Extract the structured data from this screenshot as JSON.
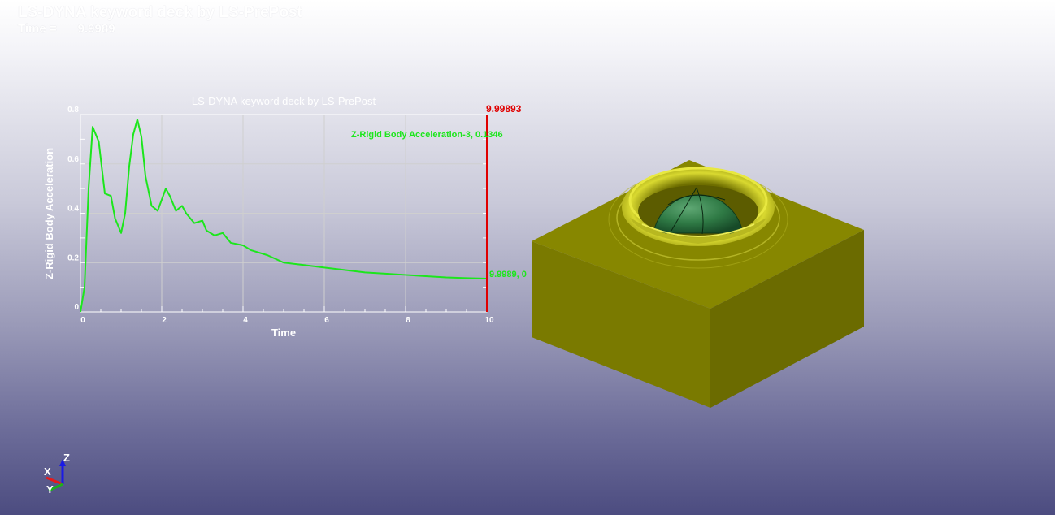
{
  "header": {
    "title": "LS-DYNA keyword deck by LS-PrePost",
    "time_label": "Time =",
    "time_value": "9.9989"
  },
  "chart_data": {
    "type": "line",
    "title": "LS-DYNA keyword deck by LS-PrePost",
    "xlabel": "Time",
    "ylabel": "Z-Rigid Body Acceleration",
    "xlim": [
      0,
      10
    ],
    "ylim": [
      0,
      0.8
    ],
    "x_ticks": [
      "0",
      "2",
      "4",
      "6",
      "8",
      "10"
    ],
    "y_ticks": [
      "0",
      "0.2",
      "0.4",
      "0.6",
      "0.8"
    ],
    "grid": true,
    "cursor_x": 10,
    "cursor_label": "9.99893",
    "series": [
      {
        "name": "Z-Rigid Body Acceleration-3, 0.1346",
        "color": "#1ce61c",
        "end_label": "9.9989, 0",
        "x": [
          0,
          0.1,
          0.2,
          0.3,
          0.45,
          0.6,
          0.75,
          0.85,
          1.0,
          1.1,
          1.2,
          1.3,
          1.4,
          1.5,
          1.6,
          1.75,
          1.9,
          2.1,
          2.2,
          2.35,
          2.5,
          2.6,
          2.8,
          3.0,
          3.1,
          3.3,
          3.5,
          3.7,
          4.0,
          4.2,
          4.6,
          5.0,
          5.5,
          6.0,
          6.5,
          7.0,
          7.5,
          8.0,
          8.5,
          9.0,
          9.5,
          10.0
        ],
        "y": [
          0,
          0.1,
          0.5,
          0.75,
          0.69,
          0.48,
          0.47,
          0.38,
          0.32,
          0.4,
          0.59,
          0.72,
          0.78,
          0.71,
          0.55,
          0.43,
          0.41,
          0.5,
          0.47,
          0.41,
          0.43,
          0.4,
          0.36,
          0.37,
          0.33,
          0.31,
          0.32,
          0.28,
          0.27,
          0.25,
          0.23,
          0.2,
          0.19,
          0.18,
          0.17,
          0.16,
          0.155,
          0.15,
          0.145,
          0.14,
          0.137,
          0.135
        ]
      }
    ]
  },
  "model": {
    "block_color": "#7a7a00",
    "sphere_color": "#2f7a45"
  },
  "triad": {
    "x_label": "X",
    "y_label": "Y",
    "z_label": "Z"
  }
}
